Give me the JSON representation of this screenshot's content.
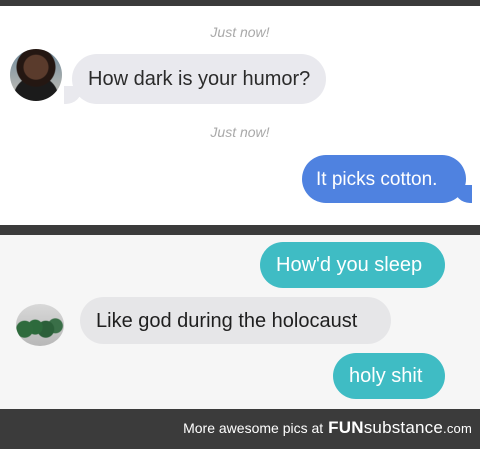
{
  "panel1": {
    "timestamp_1": "Just now!",
    "timestamp_2": "Just now!",
    "received_message": "How dark is your humor?",
    "sent_message": "It picks cotton."
  },
  "panel2": {
    "sent_message_1": "How'd you sleep",
    "received_message": "Like god during the holocaust",
    "sent_message_2": "holy shit"
  },
  "footer": {
    "prefix": "More awesome pics at",
    "brand_bold": "FUN",
    "brand_light": "substance",
    "brand_tld": ".com"
  },
  "colors": {
    "sent_blue": "#4f82e0",
    "sent_teal": "#3fbcc4",
    "received_gray": "#e9e9ee",
    "frame_dark": "#3b3b3b"
  }
}
